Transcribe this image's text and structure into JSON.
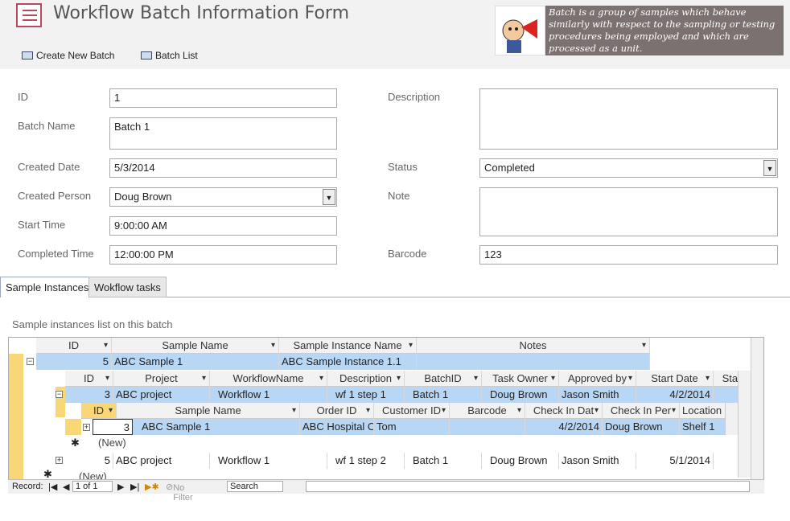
{
  "title": "Workflow Batch Information Form",
  "toolbar": {
    "create_batch": "Create New Batch",
    "batch_list": "Batch List"
  },
  "info_text": "Batch is a group of samples which behave similarly with respect to the sampling or testing procedures being employed and which are processed as a unit.",
  "form": {
    "id_label": "ID",
    "id_value": "1",
    "batch_name_label": "Batch Name",
    "batch_name_value": "Batch 1",
    "created_date_label": "Created Date",
    "created_date_value": "5/3/2014",
    "created_person_label": "Created Person",
    "created_person_value": "Doug Brown",
    "start_time_label": "Start Time",
    "start_time_value": "9:00:00 AM",
    "completed_time_label": "Completed Time",
    "completed_time_value": "12:00:00 PM",
    "description_label": "Description",
    "description_value": "",
    "status_label": "Status",
    "status_value": "Completed",
    "note_label": "Note",
    "note_value": "",
    "barcode_label": "Barcode",
    "barcode_value": "123"
  },
  "tabs": {
    "active": "Sample Instances",
    "inactive": "Wokflow tasks"
  },
  "list_caption": "Sample instances list on this batch",
  "grid": {
    "l1_headers": [
      "ID",
      "Sample Name",
      "Sample Instance Name",
      "Notes"
    ],
    "l1_row": [
      "5",
      "ABC Sample 1",
      "ABC Sample Instance 1.1",
      ""
    ],
    "l2_headers": [
      "ID",
      "Project",
      "WorkflowName",
      "Description",
      "BatchID",
      "Task Owner",
      "Approved by",
      "Start Date",
      "Star"
    ],
    "l2_row1": [
      "3",
      "ABC project",
      "Workflow 1",
      "wf 1 step 1",
      "Batch 1",
      "Doug Brown",
      "Jason Smith",
      "4/2/2014"
    ],
    "l2_row2": [
      "5",
      "ABC project",
      "Workflow 1",
      "wf 1 step 2",
      "Batch 1",
      "Doug Brown",
      "Jason Smith",
      "5/1/2014"
    ],
    "l3_headers": [
      "ID",
      "Sample Name",
      "Order ID",
      "Customer ID",
      "Barcode",
      "Check In Dat",
      "Check In Per",
      "Location Co"
    ],
    "l3_row": [
      "3",
      "ABC Sample 1",
      "ABC Hospital O",
      "Tom",
      "",
      "4/2/2014",
      "Doug Brown",
      "Shelf 1"
    ],
    "new_label": "(New)"
  },
  "nav": {
    "record_label": "Record:",
    "record_value": "1 of 1",
    "no_filter": "No Filter",
    "search": "Search"
  }
}
